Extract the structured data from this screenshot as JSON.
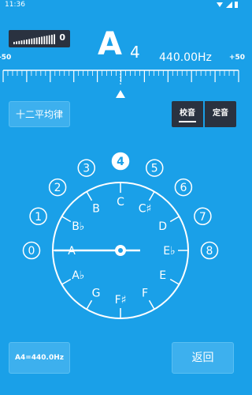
{
  "statusbar": {
    "time": "11:36"
  },
  "level": {
    "value": "0",
    "fill": 0
  },
  "note": {
    "letter": "A",
    "octave": "4",
    "frequency": "440.00Hz"
  },
  "scale": {
    "left_label": "-50",
    "right_label": "+50",
    "cents": 0
  },
  "temperament": {
    "label": "十二平均律"
  },
  "modes": {
    "tune_label": "校音",
    "pitch_label": "定音",
    "selected": "tune"
  },
  "dial": {
    "selected_octave": "4",
    "octaves": [
      "0",
      "1",
      "2",
      "3",
      "4",
      "5",
      "6",
      "7",
      "8"
    ],
    "notes": [
      "C",
      "C♯",
      "D",
      "E♭",
      "E",
      "F",
      "F♯",
      "G",
      "A♭",
      "A",
      "B♭",
      "B"
    ],
    "needle_note": "A"
  },
  "reference": {
    "label": "A4=440.0Hz"
  },
  "back": {
    "label": "返回"
  },
  "colors": {
    "background": "#1aa0e8",
    "dark": "#2a3240",
    "button": "#3db0ee",
    "text": "#ffffff"
  }
}
